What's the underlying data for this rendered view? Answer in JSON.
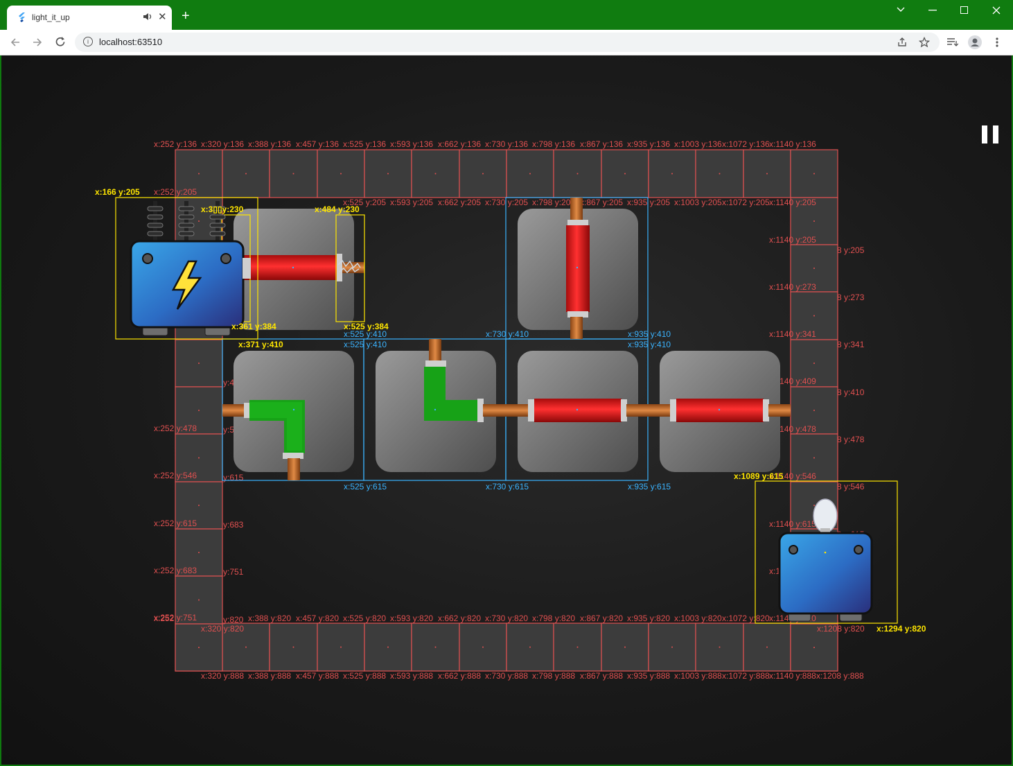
{
  "browser": {
    "tab_title": "light_it_up",
    "new_tab": "+",
    "url": "localhost:63510",
    "audio_icon": "speaker-icon",
    "close_glyph": "✕"
  },
  "colors": {
    "title_bar": "#107c10",
    "grid_line": "#e05050",
    "selected_cell": "#3ab3ff",
    "bbox": "#ffe600",
    "pipe_red": "#e01515",
    "pipe_green": "#17a217",
    "copper": "#c0692a",
    "device_blue": "#2a8fd8"
  },
  "game": {
    "pause_icon": "pause-icon",
    "grid_cols": [
      252,
      320,
      388,
      457,
      525,
      593,
      662,
      730,
      798,
      867,
      935,
      1003,
      1072,
      1140
    ],
    "grid_rows": [
      136,
      205,
      273,
      341,
      410,
      478,
      546,
      615,
      683,
      751,
      820
    ]
  },
  "labels": {
    "source_tl": "x:166 y:205",
    "pipe_in_tl": "x:3▯▯y:230",
    "pipe_end_tl": "x:484 y:230",
    "pipe_end_br": "x:525 y:384",
    "pipe_in_br": "x:361 y:384",
    "source_br": "x:371 y:410",
    "sel_tl1": "x:525 y:410",
    "sel_tl2": "x:730 y:410",
    "sel_tl3": "x:935 y:410",
    "sel_b1": "x:525 y:615",
    "sel_b2": "x:730 y:615",
    "sel_b3": "x:935 y:615",
    "bulb_tl": "x:1089 y:615",
    "bulb_br": "x:1294 y:820"
  }
}
